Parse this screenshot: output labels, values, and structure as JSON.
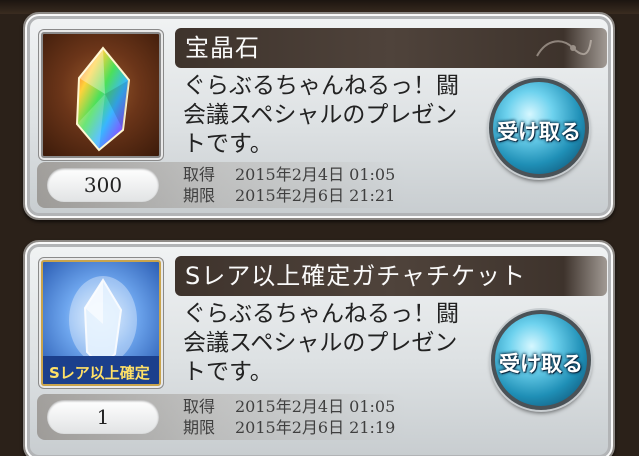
{
  "items": [
    {
      "title": "宝晶石",
      "description_lines": [
        "ぐらぶるちゃんねるっ！闘",
        "会議スペシャルのプレゼン",
        "トです。"
      ],
      "quantity": "300",
      "acquired_label": "取得",
      "acquired_value": "2015年2月4日 01:05",
      "deadline_label": "期限",
      "deadline_value": "2015年2月6日 21:21",
      "receive_label": "受け取る",
      "icon": "rainbow-crystal-icon"
    },
    {
      "title": "Sレア以上確定ガチャチケット",
      "description_lines": [
        "ぐらぶるちゃんねるっ！闘",
        "会議スペシャルのプレゼン",
        "トです。"
      ],
      "quantity": "1",
      "acquired_label": "取得",
      "acquired_value": "2015年2月4日 01:05",
      "deadline_label": "期限",
      "deadline_value": "2015年2月6日 21:19",
      "receive_label": "受け取る",
      "icon": "gacha-ticket-icon",
      "ticket_badge": "Sレア以上確定"
    }
  ],
  "colors": {
    "title_bar": "#3e332c",
    "receive_button": "#1f8fb6",
    "card_bg": "#e6e9ea"
  }
}
